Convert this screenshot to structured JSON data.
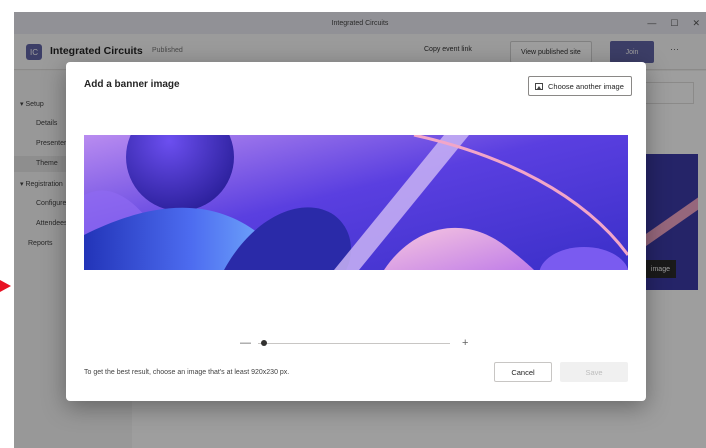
{
  "window": {
    "title": "Integrated Circuits",
    "controls": [
      "—",
      "☐",
      "✕"
    ]
  },
  "app_header": {
    "icon_text": "IC",
    "title": "Integrated Circuits",
    "status": "Published",
    "copy_link": "Copy event link",
    "view_site": "View published site",
    "join": "Join",
    "more": "···"
  },
  "sidebar": {
    "items": [
      {
        "label": "▾ Setup"
      },
      {
        "label": "Details"
      },
      {
        "label": "Presenters"
      },
      {
        "label": "Theme"
      },
      {
        "label": "▾ Registration"
      },
      {
        "label": "Configure"
      },
      {
        "label": "Attendees"
      },
      {
        "label": "Reports"
      }
    ]
  },
  "background": {
    "preview_button": "image"
  },
  "dialog": {
    "title": "Add a banner image",
    "choose_button": "Choose another image",
    "zoom": {
      "minus": "—",
      "plus": "+",
      "level": 0.03
    },
    "hint": "To get the best result, choose an image that's at least 920x230 px.",
    "cancel": "Cancel",
    "save": "Save"
  },
  "colors": {
    "accent": "#6264a7",
    "banner_primary": "#5a3fe0",
    "banner_pink": "#f2a6c8",
    "arrow": "#e81123"
  }
}
